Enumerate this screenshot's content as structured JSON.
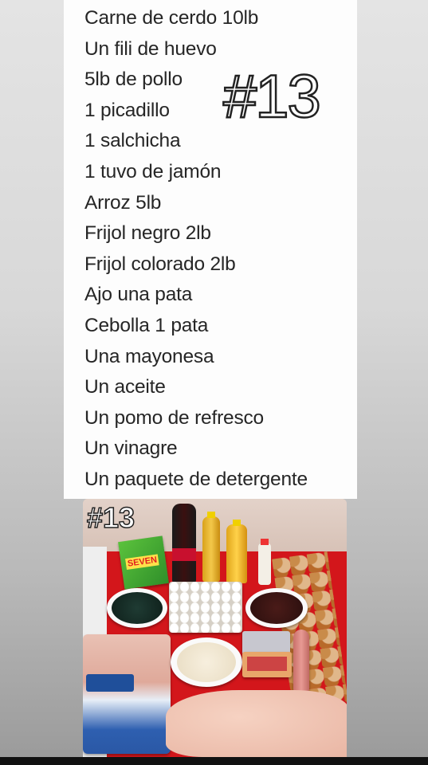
{
  "list_items": [
    "Carne de cerdo 10lb",
    "Un fili de huevo",
    "5lb de pollo",
    "1 picadillo",
    "1 salchicha",
    "1 tuvo de jamón",
    "Arroz 5lb",
    "Frijol negro 2lb",
    "Frijol colorado 2lb",
    "Ajo una pata",
    "Cebolla 1 pata",
    "Una mayonesa",
    "Un aceite",
    "Un pomo de refresco",
    "Un vinagre",
    "Un paquete de detergente"
  ],
  "tag": "#13",
  "photo_tag": "#13",
  "detergent_brand": "SEVEN",
  "colors": {
    "table_red": "#d3161b",
    "wall": "#d9c3b8",
    "text": "#262626"
  }
}
